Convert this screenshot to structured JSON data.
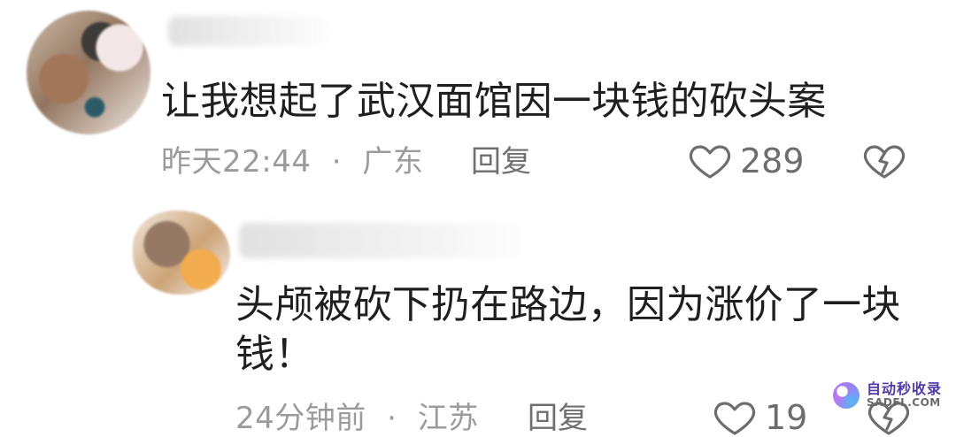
{
  "comments": [
    {
      "text": "让我想起了武汉面馆因一块钱的砍头案",
      "time": "昨天22:44",
      "separator": "·",
      "location": "广东",
      "reply_label": "回复",
      "likes": "289",
      "icons": {
        "like": "heart-outline-icon",
        "dislike": "broken-heart-icon"
      }
    },
    {
      "text_line1": "头颅被砍下扔在路边，因为涨价了一块",
      "text_line2": "钱！",
      "time": "24分钟前",
      "separator": "·",
      "location": "江苏",
      "reply_label": "回复",
      "likes": "19",
      "icons": {
        "like": "heart-outline-icon",
        "dislike": "broken-heart-icon"
      }
    }
  ],
  "watermark": {
    "title": "自动秒收录",
    "subtitle": "SADFL.COM"
  },
  "colors": {
    "text": "#1f1f1f",
    "meta": "#9b9b9b",
    "icon": "#6d6d6d",
    "watermark_title": "#4f3aa8"
  }
}
